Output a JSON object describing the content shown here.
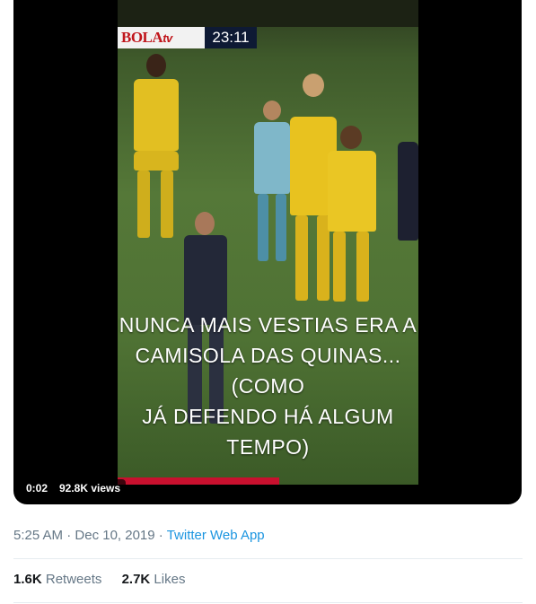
{
  "video": {
    "channel_logo": "BOLA",
    "channel_logo_suffix": "tv",
    "match_clock": "23:11",
    "caption_lines": [
      "NUNCA MAIS VESTIAS ERA A",
      "CAMISOLA DAS QUINAS...(COMO",
      "JÁ DEFENDO HÁ ALGUM TEMPO)"
    ],
    "duration": "0:02",
    "views": "92.8K views",
    "colors": {
      "kit_yellow": "#e8c21f",
      "kit_blue": "#1f4fa8",
      "pitch_green": "#557838"
    }
  },
  "tweet": {
    "time": "5:25 AM",
    "separator": "·",
    "date": "Dec 10, 2019",
    "source": "Twitter Web App",
    "retweets_count": "1.6K",
    "retweets_label": "Retweets",
    "likes_count": "2.7K",
    "likes_label": "Likes"
  }
}
